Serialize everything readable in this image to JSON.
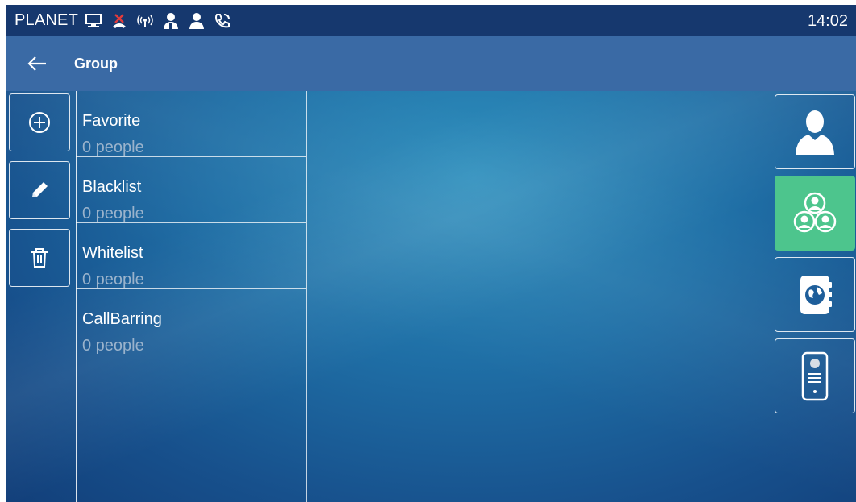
{
  "status_bar": {
    "brand": "PLANET",
    "time": "14:02",
    "icons": [
      "network-icon",
      "missed-call-icon",
      "wireless-icon",
      "user-add-icon",
      "user-icon",
      "call-forward-icon"
    ]
  },
  "header": {
    "back_icon": "arrow-left-icon",
    "title": "Group"
  },
  "toolbar": {
    "buttons": [
      {
        "name": "add-group-button",
        "icon": "plus-circle-icon"
      },
      {
        "name": "edit-group-button",
        "icon": "pencil-icon"
      },
      {
        "name": "delete-group-button",
        "icon": "trash-icon"
      }
    ]
  },
  "groups": [
    {
      "name": "Favorite",
      "count": "0 people"
    },
    {
      "name": "Blacklist",
      "count": "0 people"
    },
    {
      "name": "Whitelist",
      "count": "0 people"
    },
    {
      "name": "CallBarring",
      "count": "0 people"
    }
  ],
  "side_tabs": [
    {
      "name": "contacts",
      "icon": "person-icon",
      "active": false
    },
    {
      "name": "groups",
      "icon": "group-icon",
      "active": true
    },
    {
      "name": "phonebook",
      "icon": "address-book-icon",
      "active": false
    },
    {
      "name": "door-phone",
      "icon": "intercom-icon",
      "active": false
    }
  ],
  "colors": {
    "status_bar": "#16386e",
    "title_bar": "#3a6aa5",
    "active_tab": "#4dc58d",
    "secondary_text": "#9ab3cc"
  }
}
